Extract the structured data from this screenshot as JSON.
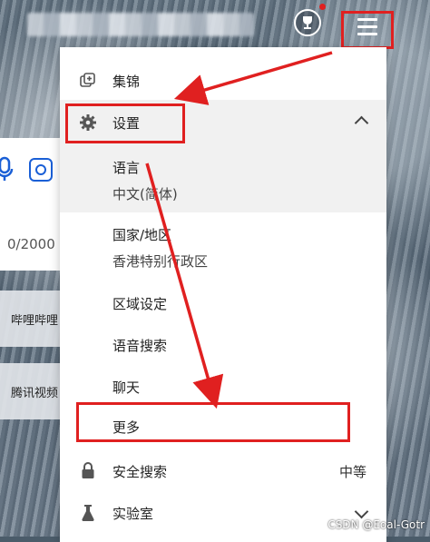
{
  "header": {
    "reward_icon": "trophy-icon",
    "menu_icon": "hamburger-icon"
  },
  "search": {
    "mic_icon": "microphone-icon",
    "camera_icon": "visual-search-icon",
    "char_count": "0/2000"
  },
  "quick_links": [
    {
      "label": "哔哩哔哩"
    },
    {
      "label": "腾讯视频"
    }
  ],
  "menu": {
    "collections": {
      "label": "集锦",
      "icon": "collections-icon"
    },
    "settings": {
      "label": "设置",
      "icon": "gear-icon"
    },
    "settings_items": {
      "language": {
        "label": "语言",
        "value": "中文(简体)"
      },
      "region": {
        "label": "国家/地区",
        "value": "香港特别行政区"
      },
      "locale": {
        "label": "区域设定"
      },
      "voice_search": {
        "label": "语音搜索"
      },
      "chat": {
        "label": "聊天"
      },
      "more": {
        "label": "更多"
      }
    },
    "safe_search": {
      "label": "安全搜索",
      "value": "中等",
      "icon": "lock-icon"
    },
    "labs": {
      "label": "实验室",
      "icon": "flask-icon"
    }
  },
  "annotation_color": "#e02020",
  "watermark": "CSDN @Eoal-Gotr"
}
